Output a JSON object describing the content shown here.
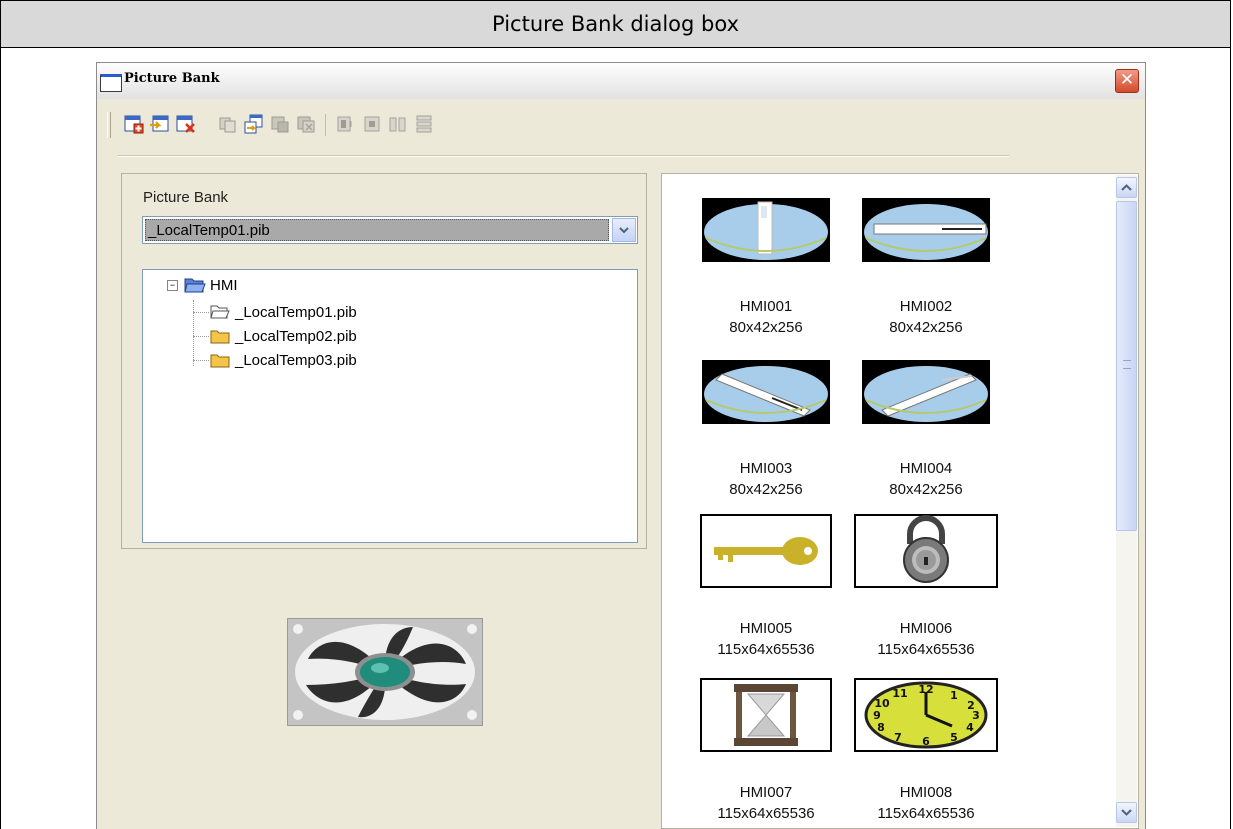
{
  "document": {
    "caption": "Picture Bank dialog box"
  },
  "window": {
    "title": "Picture Bank",
    "close_label": "✕"
  },
  "toolbar": {
    "buttons": [
      "new-bank",
      "import",
      "delete-bank",
      "copy",
      "paste",
      "cut",
      "delete",
      "align-left",
      "align-center",
      "align-justify",
      "align-rows"
    ],
    "enabled_count": 3
  },
  "picture_bank": {
    "label": "Picture Bank",
    "selected": "_LocalTemp01.pib",
    "tree": {
      "root": {
        "toggle": "−",
        "label": "HMI"
      },
      "items": [
        {
          "label": "_LocalTemp01.pib",
          "icon": "folder-open-icon"
        },
        {
          "label": "_LocalTemp02.pib",
          "icon": "folder-icon"
        },
        {
          "label": "_LocalTemp03.pib",
          "icon": "folder-icon"
        }
      ]
    }
  },
  "pictures": [
    {
      "name": "HMI001",
      "size": "80x42x256"
    },
    {
      "name": "HMI002",
      "size": "80x42x256"
    },
    {
      "name": "HMI003",
      "size": "80x42x256"
    },
    {
      "name": "HMI004",
      "size": "80x42x256"
    },
    {
      "name": "HMI005",
      "size": "115x64x65536"
    },
    {
      "name": "HMI006",
      "size": "115x64x65536"
    },
    {
      "name": "HMI007",
      "size": "115x64x65536"
    },
    {
      "name": "HMI008",
      "size": "115x64x65536"
    }
  ],
  "scrollbar": {
    "up": "▲",
    "down": "▼"
  }
}
